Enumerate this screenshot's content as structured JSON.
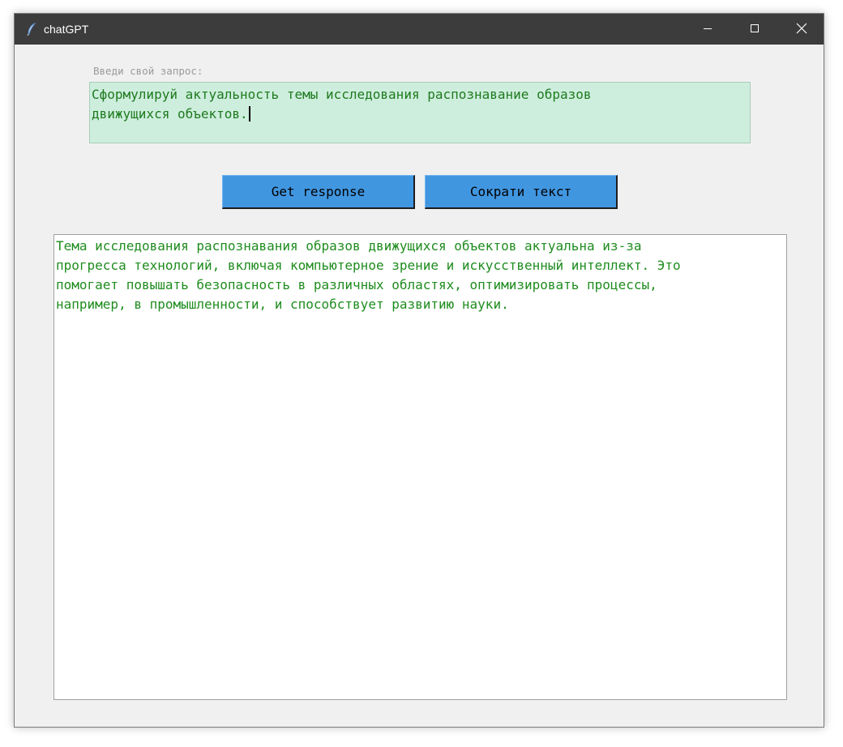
{
  "window": {
    "title": "chatGPT",
    "icons": {
      "app": "feather-icon",
      "minimize": "minimize-icon",
      "maximize": "maximize-icon",
      "close": "close-icon"
    }
  },
  "prompt": {
    "label": "Введи свой запрос:",
    "value": "Сформулируй актуальность темы исследования распознавание образов\nдвижущихся объектов."
  },
  "buttons": {
    "get_response": "Get response",
    "shorten": "Сократи текст"
  },
  "response": {
    "text": "Тема исследования распознавания образов движущихся объектов актуальна из-за\nпрогресса технологий, включая компьютерное зрение и искусственный интеллект. Это\nпомогает повышать безопасность в различных областях, оптимизировать процессы,\nнапример, в промышленности, и способствует развитию науки."
  },
  "colors": {
    "titlebar": "#3c3c3c",
    "input_background": "#cdeedd",
    "button": "#4196e0",
    "text_green": "#1e8c1e"
  }
}
